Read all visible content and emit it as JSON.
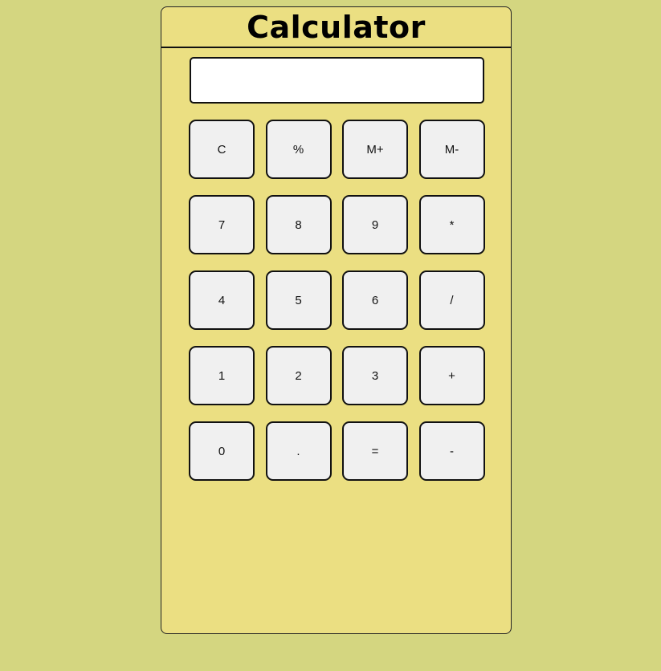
{
  "app": {
    "title": "Calculator"
  },
  "display": {
    "value": ""
  },
  "keys": [
    {
      "label": "C",
      "name": "clear-button"
    },
    {
      "label": "%",
      "name": "percent-button"
    },
    {
      "label": "M+",
      "name": "memory-add-button"
    },
    {
      "label": "M-",
      "name": "memory-subtract-button"
    },
    {
      "label": "7",
      "name": "digit-7-button"
    },
    {
      "label": "8",
      "name": "digit-8-button"
    },
    {
      "label": "9",
      "name": "digit-9-button"
    },
    {
      "label": "*",
      "name": "multiply-button"
    },
    {
      "label": "4",
      "name": "digit-4-button"
    },
    {
      "label": "5",
      "name": "digit-5-button"
    },
    {
      "label": "6",
      "name": "digit-6-button"
    },
    {
      "label": "/",
      "name": "divide-button"
    },
    {
      "label": "1",
      "name": "digit-1-button"
    },
    {
      "label": "2",
      "name": "digit-2-button"
    },
    {
      "label": "3",
      "name": "digit-3-button"
    },
    {
      "label": "+",
      "name": "add-button"
    },
    {
      "label": "0",
      "name": "digit-0-button"
    },
    {
      "label": ".",
      "name": "decimal-point-button"
    },
    {
      "label": "=",
      "name": "equals-button"
    },
    {
      "label": "-",
      "name": "subtract-button"
    }
  ],
  "colors": {
    "page_background": "#d4d680",
    "calculator_background": "#ebdf82",
    "key_background": "#f0f0f0",
    "display_background": "#ffffff"
  }
}
